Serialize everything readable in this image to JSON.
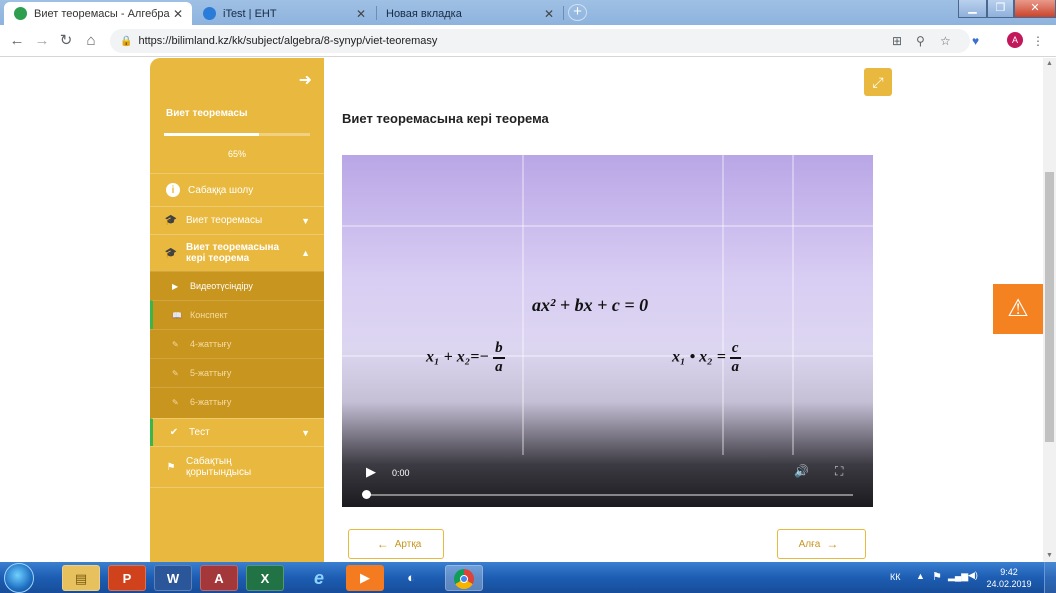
{
  "browser": {
    "tabs": [
      {
        "title": "Виет теоремасы - Алгебра, оқу",
        "favicon_color": "#2e9e4f"
      },
      {
        "title": "iTest | ЕНТ",
        "favicon_color": "#2b7bd8"
      },
      {
        "title": "Новая вкладка",
        "favicon_color": ""
      }
    ],
    "url": "https://bilimland.kz/kk/subject/algebra/8-synyp/viet-teoremasy",
    "profile_initial": "A"
  },
  "sidebar": {
    "course_title": "Виет теоремасы",
    "progress_fraction": 0.65,
    "progress_label": "65%",
    "items": [
      {
        "label": "Сабаққа шолу",
        "icon": "info-icon"
      },
      {
        "label": "Виет теоремасы",
        "icon": "graduation-cap-icon",
        "expanded": false
      },
      {
        "label": "Виет теоремасына кері теорема",
        "icon": "graduation-cap-icon",
        "expanded": true
      },
      {
        "label": "Тест",
        "icon": "check-circle-icon",
        "expanded": false
      },
      {
        "label": "Сабақтың қорытындысы",
        "icon": "flag-icon"
      }
    ],
    "sub_items": [
      {
        "label": "Видеотүсіндіру",
        "icon": "play-icon"
      },
      {
        "label": "Конспект",
        "icon": "book-icon"
      },
      {
        "label": "4-жаттығу",
        "icon": "edit-icon"
      },
      {
        "label": "5-жаттығу",
        "icon": "edit-icon"
      },
      {
        "label": "6-жаттығу",
        "icon": "edit-icon"
      }
    ]
  },
  "main": {
    "lesson_title": "Виет теоремасына кері теорема",
    "video": {
      "time": "0:00",
      "equation_main": {
        "lhs": "ax² + bx + c = 0"
      },
      "sum": {
        "lhs": "x₁ + x₂=−",
        "num": "b",
        "den": "a"
      },
      "product": {
        "lhs": "x₁ • x₂ =",
        "num": "c",
        "den": "a"
      },
      "progress_fraction": 0.0
    },
    "prev_label": "Артқа",
    "next_label": "Алға"
  },
  "taskbar": {
    "lang": "КК",
    "time": "9:42",
    "date": "24.02.2019"
  },
  "colors": {
    "accent": "#e9b93f",
    "accent_dark": "#c8951e",
    "report": "#f58220",
    "active_marker": "#39b54a"
  }
}
